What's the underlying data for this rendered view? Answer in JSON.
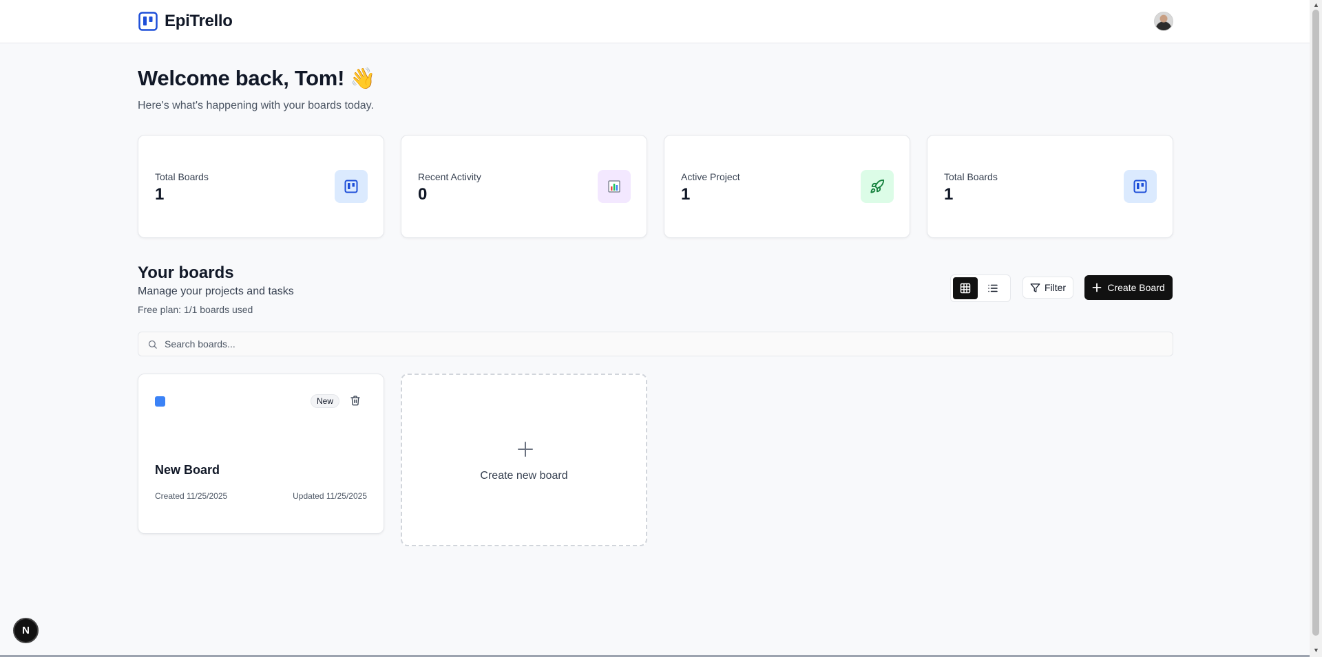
{
  "app": {
    "name": "EpiTrello"
  },
  "header": {
    "welcome": "Welcome back, Tom!",
    "wave_emoji": "👋",
    "subtitle": "Here's what's happening with your boards today."
  },
  "stats": [
    {
      "label": "Total Boards",
      "value": "1",
      "icon": "board-icon",
      "color": "#dbeafe"
    },
    {
      "label": "Recent Activity",
      "value": "0",
      "icon": "bar-chart-icon",
      "color": "#f3e8ff"
    },
    {
      "label": "Active Project",
      "value": "1",
      "icon": "rocket-icon",
      "color": "#dcfce7"
    },
    {
      "label": "Total Boards",
      "value": "1",
      "icon": "board-icon",
      "color": "#dbeafe"
    }
  ],
  "boards_section": {
    "title": "Your boards",
    "subtitle": "Manage your projects and tasks",
    "plan": "Free plan: 1/1 boards used",
    "filter_label": "Filter",
    "create_label": "Create Board",
    "search_placeholder": "Search boards..."
  },
  "boards": [
    {
      "name": "New Board",
      "badge": "New",
      "created": "Created 11/25/2025",
      "updated": "Updated 11/25/2025",
      "color": "#3b82f6"
    }
  ],
  "new_board_card": {
    "label": "Create new board"
  },
  "dev_badge": {
    "label": "N"
  },
  "colors": {
    "accent": "#1d4ed8",
    "dark": "#111111"
  }
}
